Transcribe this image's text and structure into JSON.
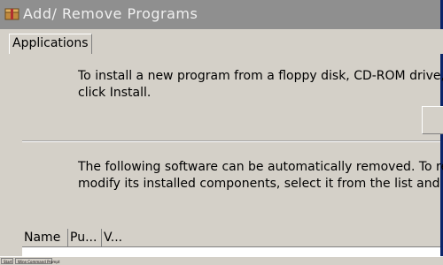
{
  "window": {
    "title": "Add/ Remove Programs",
    "icon": "box-icon"
  },
  "tabs": [
    {
      "label": "Applications",
      "selected": true
    }
  ],
  "install_section": {
    "line1": "To install a new program from a floppy disk, CD-ROM drive, or your",
    "line2": "click Install."
  },
  "remove_section": {
    "line1": "The following software can be automatically removed. To remove a",
    "line2": "modify its installed components, select it from the list and click Mod"
  },
  "list": {
    "columns": [
      "Name",
      "Pu...",
      "V..."
    ]
  },
  "taskbar": {
    "start_label": "Start",
    "items": [
      "Wine Command Prompt"
    ]
  },
  "colors": {
    "titlebar": "#8f8f8f",
    "face": "#d4d0c8",
    "accent_edge": "#0a246a"
  }
}
